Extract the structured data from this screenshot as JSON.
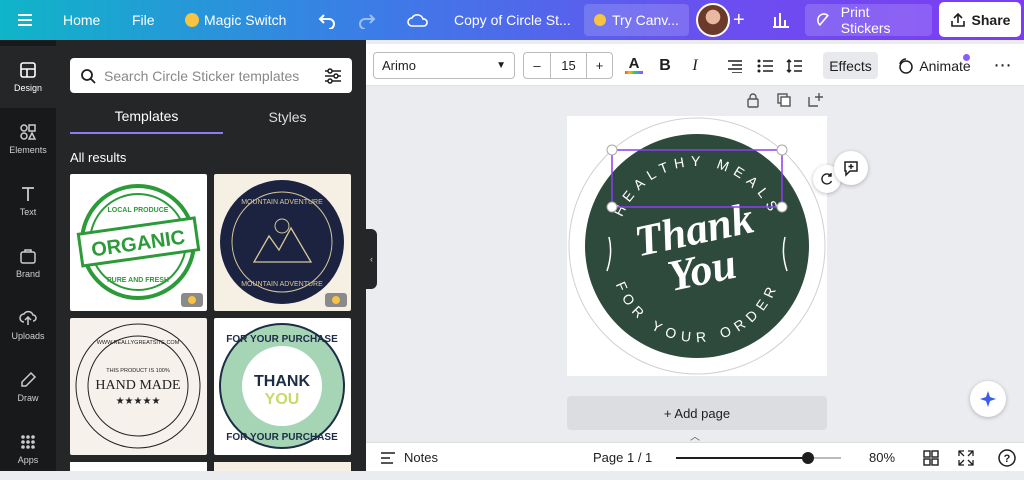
{
  "topbar": {
    "home": "Home",
    "file": "File",
    "magic_switch": "Magic Switch",
    "doc_title": "Copy of Circle St...",
    "try_canva": "Try Canv...",
    "print_stickers": "Print Stickers",
    "share": "Share"
  },
  "sidebar": {
    "items": [
      {
        "label": "Design",
        "icon": "layout-icon"
      },
      {
        "label": "Elements",
        "icon": "shapes-icon"
      },
      {
        "label": "Text",
        "icon": "text-icon"
      },
      {
        "label": "Brand",
        "icon": "brand-icon"
      },
      {
        "label": "Uploads",
        "icon": "upload-icon"
      },
      {
        "label": "Draw",
        "icon": "draw-icon"
      },
      {
        "label": "Apps",
        "icon": "apps-icon"
      }
    ]
  },
  "panel": {
    "search_placeholder": "Search Circle Sticker templates",
    "tabs": [
      "Templates",
      "Styles"
    ],
    "results_label": "All results",
    "templates": [
      {
        "name": "organic-stamp",
        "lines": [
          "LOCAL PRODUCE",
          "ORGANIC",
          "PURE AND FRESH"
        ],
        "color": "#2d9a3a"
      },
      {
        "name": "mountain-adventure",
        "lines": [
          "MOUNTAIN ADVENTURE",
          "MOUNTAIN ADVENTURE"
        ],
        "color": "#1c2340"
      },
      {
        "name": "hand-made",
        "lines": [
          "WWW.REALLYGREATSITE.COM",
          "THIS PRODUCT IS 100%",
          "HAND MADE",
          "★★★★★"
        ],
        "color": "#222222"
      },
      {
        "name": "thank-you-purchase",
        "lines": [
          "FOR YOUR PURCHASE",
          "THANK",
          "YOU",
          "FOR YOUR PURCHASE"
        ],
        "color": "#a6d5b5"
      }
    ]
  },
  "toolbar": {
    "font": "Arimo",
    "font_size": "15",
    "minus": "–",
    "plus": "+",
    "effects": "Effects",
    "animate": "Animate"
  },
  "design": {
    "top_arc": "HEALTHY MEALS",
    "bottom_arc": "FOR YOUR ORDER",
    "script_line1": "Thank",
    "script_line2": "You",
    "bg_color": "#2e4a3d"
  },
  "add_page": "+ Add page",
  "footer": {
    "notes": "Notes",
    "page": "Page 1 / 1",
    "zoom": "80%",
    "zoom_fraction": 0.8
  }
}
